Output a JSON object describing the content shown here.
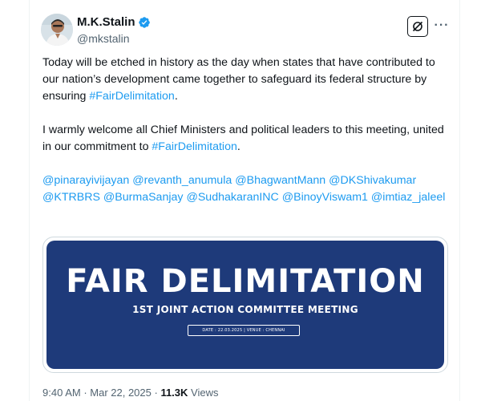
{
  "author": {
    "display_name": "M.K.Stalin",
    "handle": "@mkstalin",
    "verified": true
  },
  "tweet": {
    "paragraph1_text": "Today will be etched in history as the day when states that have contributed to our nation’s development came together to safeguard its federal structure by ensuring ",
    "paragraph1_hashtag": "#FairDelimitation",
    "paragraph1_end": ".",
    "paragraph2_text": "I warmly welcome all Chief Ministers and political leaders to this meeting, united in our commitment to ",
    "paragraph2_hashtag": "#FairDelimitation",
    "paragraph2_end": ".",
    "mentions": [
      "@pinarayivijayan",
      "@revanth_anumula",
      "@BhagwantMann",
      "@DKShivakumar",
      "@KTRBRS",
      "@BurmaSanjay",
      "@SudhakaranINC",
      "@BinoyViswam1",
      "@imtiaz_jaleel"
    ]
  },
  "media": {
    "title": "FAIR DELIMITATION",
    "subtitle": "1ST JOINT ACTION COMMITTEE MEETING",
    "date_line": "DATE : 22.03.2025 | VENUE : CHENNAI"
  },
  "meta": {
    "time": "9:40 AM",
    "separator": " · ",
    "date": "Mar 22, 2025",
    "views_count": "11.3K",
    "views_label": "Views"
  },
  "icons": {
    "grok": "grok-icon",
    "more": "more-icon",
    "verified": "verified-badge-icon"
  },
  "colors": {
    "link": "#1d9bf0",
    "banner_bg": "#1e3a7a",
    "text": "#0f1419",
    "muted": "#536471"
  }
}
